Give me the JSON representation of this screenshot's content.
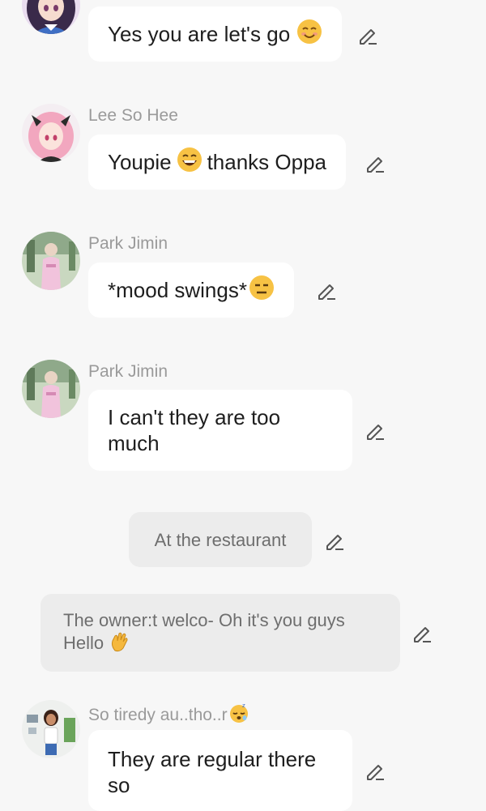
{
  "messages": [
    {
      "type": "character",
      "author": "",
      "text": "Yes you are let's go",
      "emoji": "smiling-blush-emoji"
    },
    {
      "type": "character",
      "author": "Lee So Hee",
      "text": "Youpie",
      "text_after": "thanks Oppa",
      "emoji": "grinning-emoji"
    },
    {
      "type": "character",
      "author": "Park Jimin",
      "text": "*mood swings*",
      "emoji": "expressionless-emoji"
    },
    {
      "type": "character",
      "author": "Park Jimin",
      "text": "I can't they are too much"
    },
    {
      "type": "narration",
      "text": "At the restaurant"
    },
    {
      "type": "narration",
      "text": "The owner:t welco- Oh it's you guys Hello",
      "emoji": "waving-hand-emoji"
    },
    {
      "type": "character",
      "author": "So tiredy au..tho..r",
      "author_emoji": "sleeping-face-emoji",
      "text": "They are regular there so"
    }
  ],
  "colors": {
    "background": "#f7f7f7",
    "bubble": "#ffffff",
    "narration_bubble": "#ececec",
    "author_text": "#9a9a9a",
    "icon": "#555555"
  }
}
